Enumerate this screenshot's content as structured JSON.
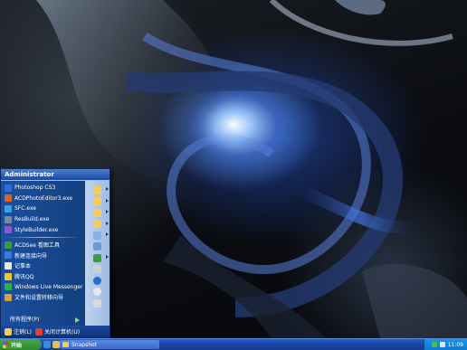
{
  "start_menu": {
    "user_name": "Administrator",
    "pinned_items": [
      {
        "label": "Photoshop CS3",
        "icon": "photoshop-icon",
        "color": "#2b6fd6"
      },
      {
        "label": "ACDPhotoEditor3.exe",
        "icon": "acdsee-editor-icon",
        "color": "#d9652a"
      },
      {
        "label": "SFC.exe",
        "icon": "sfc-icon",
        "color": "#3aa0e8"
      },
      {
        "label": "ResBuild.exe",
        "icon": "resbuild-icon",
        "color": "#7a8a9a"
      },
      {
        "label": "StyleBuilder.exe",
        "icon": "stylebuilder-icon",
        "color": "#8a5ad0"
      }
    ],
    "recent_items": [
      {
        "label": "ACDSee 看图工具",
        "icon": "acdsee-icon",
        "color": "#3c9b3c"
      },
      {
        "label": "新建连接向导",
        "icon": "network-wizard-icon",
        "color": "#3a7ad8"
      },
      {
        "label": "记事本",
        "icon": "notepad-icon",
        "color": "#e8e8e0"
      },
      {
        "label": "腾讯QQ",
        "icon": "qq-penguin-icon",
        "color": "#f4c430"
      },
      {
        "label": "Windows Live Messenger",
        "icon": "messenger-icon",
        "color": "#2ab04a"
      },
      {
        "label": "文件和设置转移向导",
        "icon": "transfer-wizard-icon",
        "color": "#d8a040"
      }
    ],
    "all_programs_label": "所有程序(P)",
    "right_pane_icons": [
      {
        "icon": "my-documents-icon",
        "color": "#f2cd5c",
        "submenu": true
      },
      {
        "icon": "my-recent-documents-icon",
        "color": "#f2cd5c",
        "submenu": true
      },
      {
        "icon": "my-pictures-icon",
        "color": "#f2cd5c",
        "submenu": true
      },
      {
        "icon": "my-music-icon",
        "color": "#f2cd5c",
        "submenu": true
      },
      {
        "icon": "my-computer-icon",
        "color": "#8ab0e0",
        "submenu": true
      },
      {
        "icon": "control-panel-icon",
        "color": "#6a9ad8",
        "submenu": false
      },
      {
        "icon": "network-connections-icon",
        "color": "#3c9b3c",
        "submenu": true
      },
      {
        "icon": "printers-faxes-icon",
        "color": "#d0d0d0",
        "submenu": false
      },
      {
        "icon": "help-icon",
        "color": "#2a6ad0",
        "submenu": false
      },
      {
        "icon": "search-icon",
        "color": "#e8e8e8",
        "submenu": false
      },
      {
        "icon": "run-icon",
        "color": "#d8d8d8",
        "submenu": false
      }
    ],
    "logoff_label": "注销(L)",
    "shutdown_label": "关闭计算机(U)"
  },
  "taskbar": {
    "start_label": "开始",
    "task_button_label": "Snapshot",
    "clock": "11:09",
    "colors": {
      "start": "#2d8a2d",
      "bar": "#1d47a8",
      "tray": "#0d7ad0"
    }
  }
}
